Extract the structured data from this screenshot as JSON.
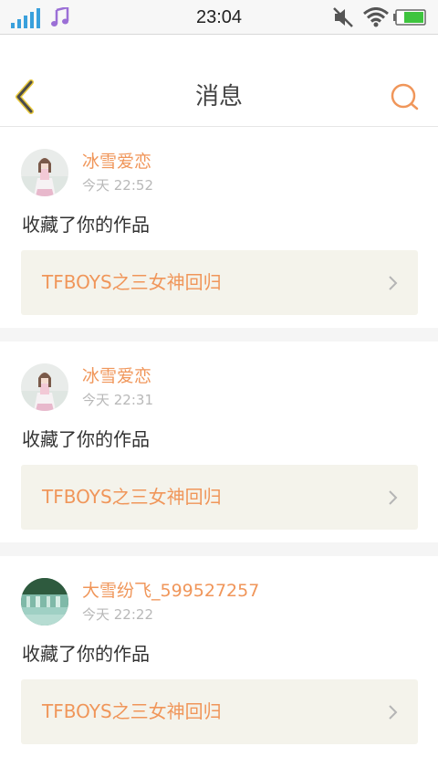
{
  "status_bar": {
    "time": "23:04",
    "icons": [
      "signal-icon",
      "music-icon",
      "mute-icon",
      "wifi-icon",
      "battery-icon"
    ]
  },
  "header": {
    "title": "消息",
    "back_icon": "chevron-left-icon",
    "search_icon": "search-icon"
  },
  "colors": {
    "accent": "#f0965a",
    "back_arrow": "#e8c93c",
    "card_bg": "#f4f3eb",
    "timestamp": "#b8b8b8"
  },
  "messages": [
    {
      "username": "冰雪爱恋",
      "timestamp": "今天 22:52",
      "action": "收藏了你的作品",
      "work_title": "TFBOYS之三女神回归",
      "avatar": "girl-photo"
    },
    {
      "username": "冰雪爱恋",
      "timestamp": "今天 22:31",
      "action": "收藏了你的作品",
      "work_title": "TFBOYS之三女神回归",
      "avatar": "girl-photo"
    },
    {
      "username": "大雪纷飞_599527257",
      "timestamp": "今天 22:22",
      "action": "收藏了你的作品",
      "work_title": "TFBOYS之三女神回归",
      "avatar": "waterfall-photo"
    }
  ]
}
